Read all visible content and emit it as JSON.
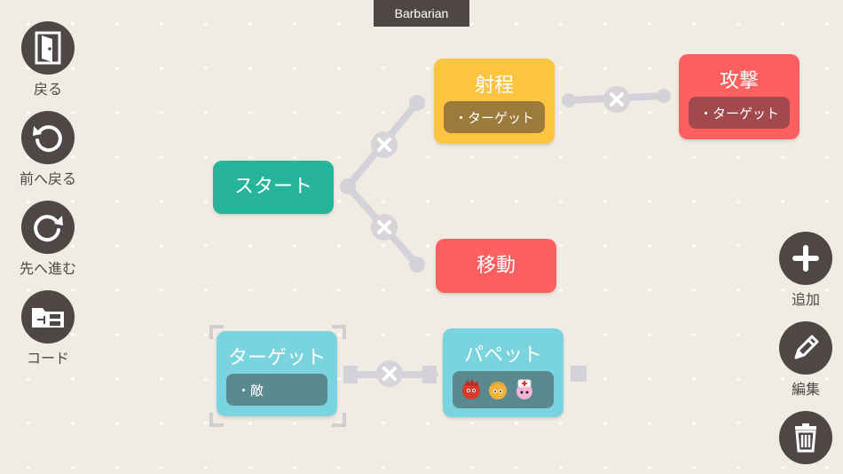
{
  "window": {
    "title": "Barbarian"
  },
  "sidebar": {
    "back": {
      "label": "戻る",
      "icon": "door-exit-icon"
    },
    "undo": {
      "label": "前へ戻る",
      "icon": "undo-icon"
    },
    "redo": {
      "label": "先へ進む",
      "icon": "redo-icon"
    },
    "code": {
      "label": "コード",
      "icon": "code-folder-icon"
    }
  },
  "right_toolbar": {
    "add": {
      "label": "追加",
      "icon": "plus-icon"
    },
    "edit": {
      "label": "編集",
      "icon": "pencil-icon"
    },
    "delete": {
      "icon": "trash-icon"
    }
  },
  "nodes": {
    "start": {
      "title": "スタート",
      "color": "#26b49a"
    },
    "range": {
      "title": "射程",
      "param": "・ターゲット",
      "color": "#fcc440"
    },
    "attack": {
      "title": "攻撃",
      "param": "・ターゲット",
      "color": "#ff5f5f"
    },
    "move": {
      "title": "移動",
      "color": "#ff5f5f"
    },
    "target": {
      "title": "ターゲット",
      "param": "・敵",
      "color": "#79d4e0"
    },
    "puppet": {
      "title": "パペット",
      "color": "#79d4e0",
      "icons": [
        "red-puppet-icon",
        "yellow-puppet-icon",
        "nurse-puppet-icon"
      ]
    }
  }
}
